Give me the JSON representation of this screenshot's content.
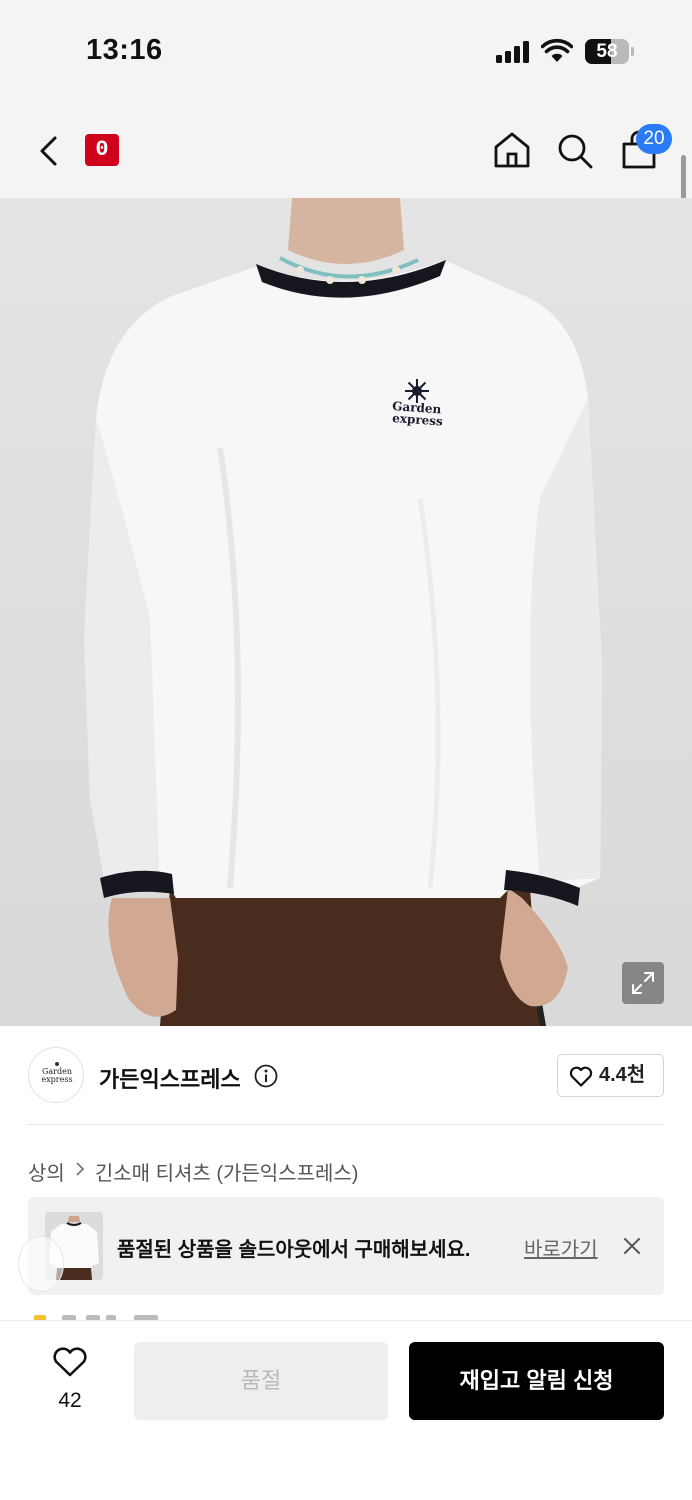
{
  "status_bar": {
    "time": "13:16",
    "battery_level": "58",
    "battery_percent": 58,
    "signal_icon": "cellular-signal-icon",
    "wifi_icon": "wifi-icon"
  },
  "nav": {
    "back_icon": "chevron-left-icon",
    "logo_text": "0",
    "logo_color": "#d0021b",
    "home_icon": "home-icon",
    "search_icon": "search-icon",
    "cart_icon": "shopping-bag-icon",
    "cart_count": "20",
    "cart_badge_color": "#2a7bf6"
  },
  "product_image": {
    "chest_logo_line1": "Garden",
    "chest_logo_line2": "express",
    "expand_icon": "expand-icon"
  },
  "brand": {
    "avatar_line1": "Garden",
    "avatar_line2": "express",
    "name": "가든익스프레스",
    "info_icon": "info-icon",
    "like_icon": "heart-outline-icon",
    "like_count": "4.4천"
  },
  "breadcrumb": {
    "category": "상의",
    "subcategory": "긴소매 티셔츠 (가든익스프레스)"
  },
  "soldout_banner": {
    "message": "품절된 상품을 솔드아웃에서 구매해보세요.",
    "link_label": "바로가기",
    "close_icon": "close-icon"
  },
  "bottom_bar": {
    "wish_icon": "heart-outline-icon",
    "wish_count": "42",
    "soldout_label": "품절",
    "restock_label": "재입고 알림 신청"
  }
}
